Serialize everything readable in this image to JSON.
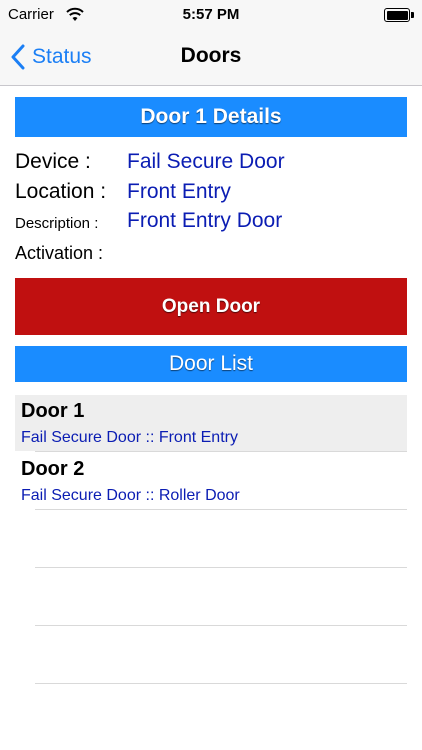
{
  "status_bar": {
    "carrier": "Carrier",
    "time": "5:57 PM",
    "wifi_icon": "wifi-icon",
    "battery_icon": "battery-icon"
  },
  "nav": {
    "back_label": "Status",
    "title": "Doors"
  },
  "details": {
    "header": "Door 1 Details",
    "device_label": "Device :",
    "device_value": "Fail Secure Door",
    "location_label": "Location :",
    "location_value": "Front Entry",
    "description_label": "Description :",
    "description_value": "Front Entry Door",
    "activation_label": "Activation :",
    "activation_value": ""
  },
  "open_button": "Open Door",
  "door_list": {
    "header": "Door List",
    "items": [
      {
        "name": "Door 1",
        "detail": "Fail Secure Door :: Front Entry",
        "selected": true
      },
      {
        "name": "Door 2",
        "detail": "Fail Secure Door :: Roller Door",
        "selected": false
      }
    ]
  },
  "colors": {
    "accent_blue": "#1a8cff",
    "link_blue": "#1b7ff5",
    "value_blue": "#0b1db3",
    "danger_red": "#c01010"
  }
}
